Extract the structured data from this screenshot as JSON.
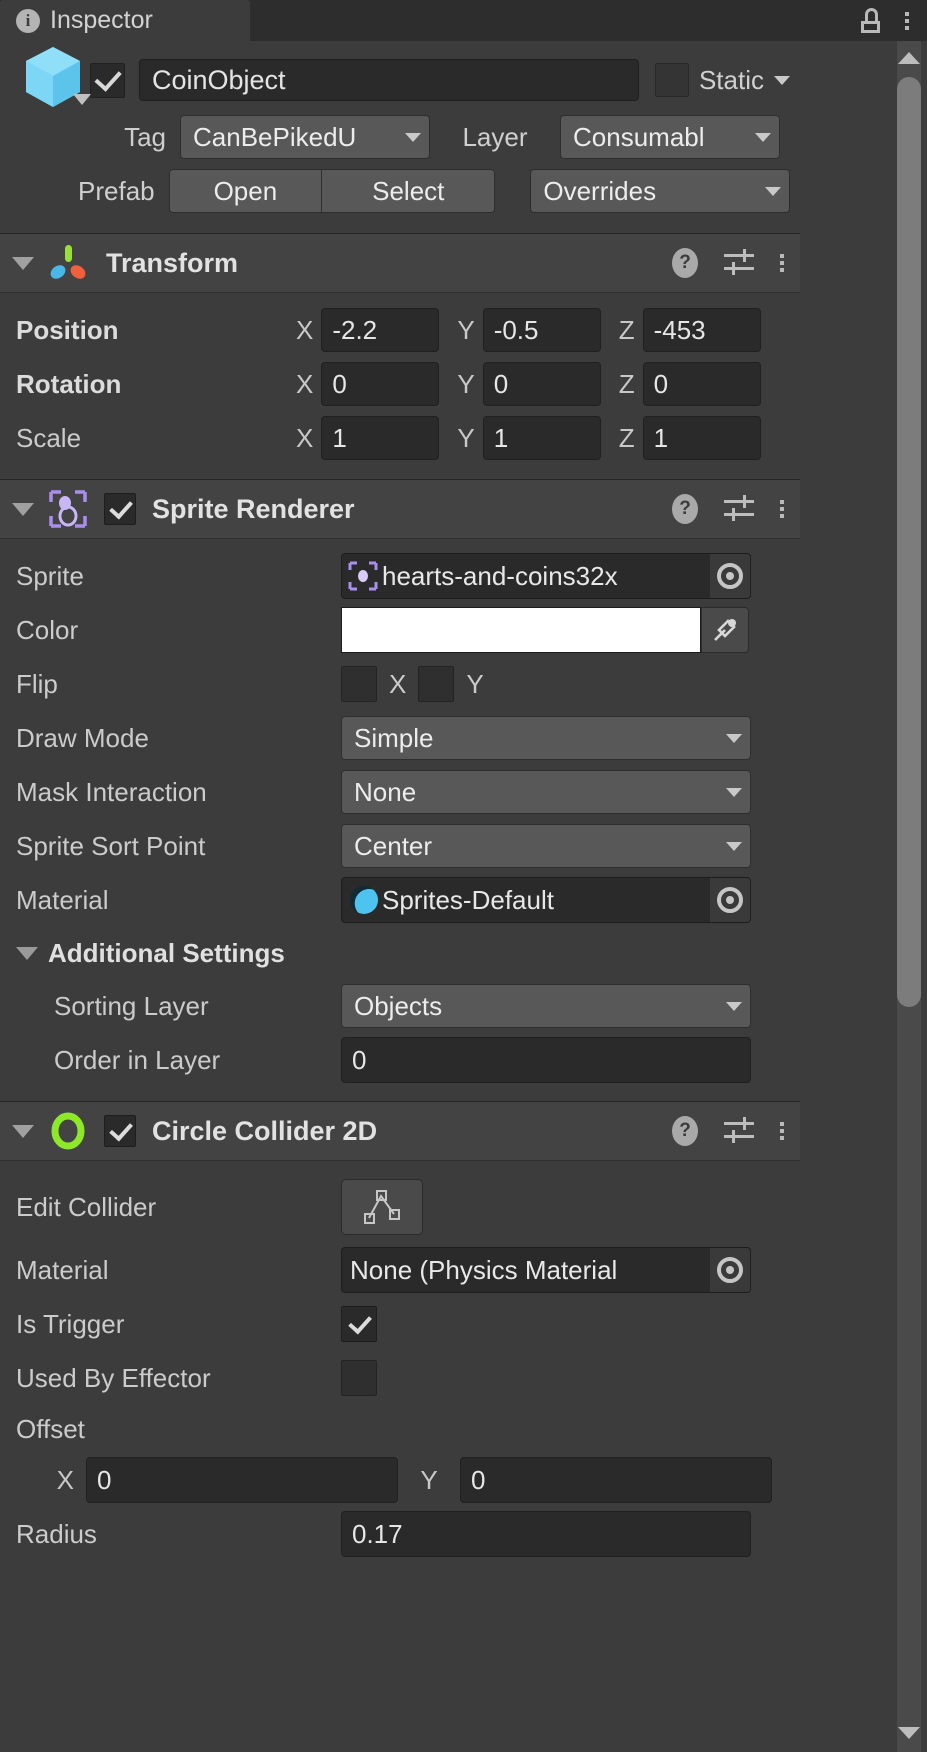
{
  "window": {
    "tab_label": "Inspector",
    "tab_icon": "info-icon",
    "lock_icon": "lock-open-icon",
    "menu_icon": "kebab-menu-icon"
  },
  "game_object": {
    "name": "CoinObject",
    "active": true,
    "static_label": "Static",
    "static_checked": false,
    "tag_label": "Tag",
    "tag_value": "CanBePikedU",
    "layer_label": "Layer",
    "layer_value": "Consumabl",
    "prefab_label": "Prefab",
    "prefab_open": "Open",
    "prefab_select": "Select",
    "prefab_overrides": "Overrides"
  },
  "transform": {
    "title": "Transform",
    "rows": [
      {
        "label": "Position",
        "x": "-2.2",
        "y": "-0.5",
        "z": "-453"
      },
      {
        "label": "Rotation",
        "x": "0",
        "y": "0",
        "z": "0"
      },
      {
        "label": "Scale",
        "x": "1",
        "y": "1",
        "z": "1"
      }
    ],
    "axis_x": "X",
    "axis_y": "Y",
    "axis_z": "Z"
  },
  "sprite_renderer": {
    "title": "Sprite Renderer",
    "enabled": true,
    "sprite_label": "Sprite",
    "sprite_value": "hearts-and-coins32x",
    "color_label": "Color",
    "color_value": "#FFFFFF",
    "flip_label": "Flip",
    "flip_x_label": "X",
    "flip_y_label": "Y",
    "flip_x": false,
    "flip_y": false,
    "draw_mode_label": "Draw Mode",
    "draw_mode_value": "Simple",
    "mask_interaction_label": "Mask Interaction",
    "mask_interaction_value": "None",
    "sprite_sort_point_label": "Sprite Sort Point",
    "sprite_sort_point_value": "Center",
    "material_label": "Material",
    "material_value": "Sprites-Default",
    "additional_settings_label": "Additional Settings",
    "sorting_layer_label": "Sorting Layer",
    "sorting_layer_value": "Objects",
    "order_in_layer_label": "Order in Layer",
    "order_in_layer_value": "0"
  },
  "circle_collider": {
    "title": "Circle Collider 2D",
    "enabled": true,
    "edit_collider_label": "Edit Collider",
    "material_label": "Material",
    "material_value": "None (Physics Material",
    "is_trigger_label": "Is Trigger",
    "is_trigger": true,
    "used_by_effector_label": "Used By Effector",
    "used_by_effector": false,
    "offset_label": "Offset",
    "offset_x_axis": "X",
    "offset_x": "0",
    "offset_y_axis": "Y",
    "offset_y": "0",
    "radius_label": "Radius",
    "radius_value": "0.17"
  },
  "colors": {
    "panel_bg": "#3c3c3c",
    "header_bg": "#434343",
    "field_bg": "#2a2a2a",
    "dropdown_bg": "#585858",
    "text": "#cbcbcb",
    "collider_green": "#8ee82a",
    "sprite_purple": "#a98ef0",
    "cube_blue": "#6fd2f5"
  }
}
